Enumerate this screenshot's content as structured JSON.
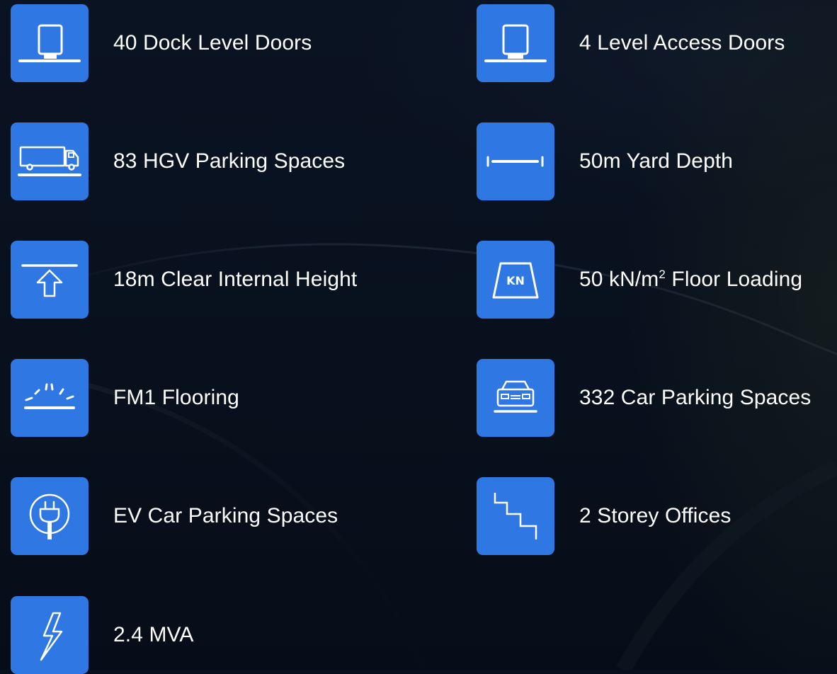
{
  "features": [
    {
      "icon": "dock-door-icon",
      "label": "40 Dock Level Doors"
    },
    {
      "icon": "level-access-door-icon",
      "label": "4 Level Access Doors"
    },
    {
      "icon": "truck-icon",
      "label": "83 HGV Parking Spaces"
    },
    {
      "icon": "yard-depth-icon",
      "label": "50m Yard Depth"
    },
    {
      "icon": "height-arrow-icon",
      "label": "18m Clear Internal Height"
    },
    {
      "icon": "kn-weight-icon",
      "label": "50 kN/m",
      "label_sup": "2",
      "label_suffix": " Floor Loading",
      "icon_text": "KN"
    },
    {
      "icon": "flooring-icon",
      "label": "FM1 Flooring"
    },
    {
      "icon": "car-icon",
      "label": "332 Car Parking Spaces"
    },
    {
      "icon": "ev-plug-icon",
      "label": "EV Car Parking Spaces"
    },
    {
      "icon": "stairs-icon",
      "label": "2 Storey Offices"
    },
    {
      "icon": "lightning-icon",
      "label": "2.4 MVA"
    }
  ],
  "colors": {
    "tile": "#2f78e3",
    "background": "#08101d",
    "text": "#ffffff"
  }
}
